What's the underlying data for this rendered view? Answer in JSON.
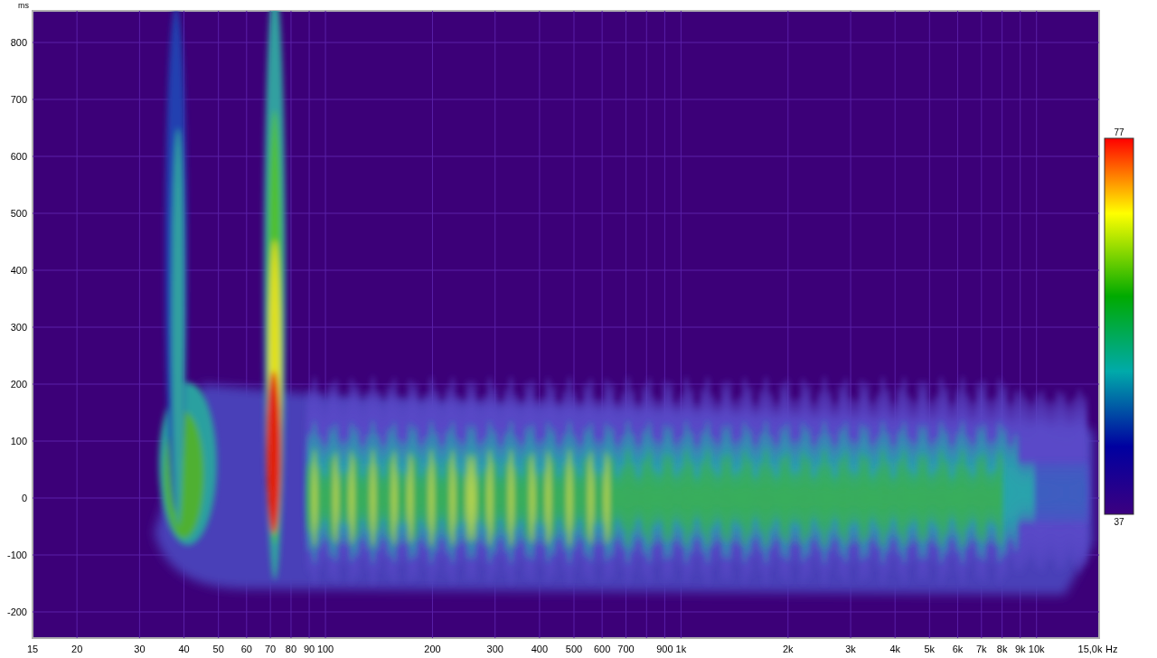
{
  "y_axis": {
    "unit": "ms",
    "ticks": [
      "800",
      "700",
      "600",
      "500",
      "400",
      "300",
      "200",
      "100",
      "0",
      "-100",
      "-200"
    ]
  },
  "x_axis": {
    "unit": "Hz",
    "ticks": [
      "15",
      "20",
      "30",
      "40",
      "50",
      "60",
      "70",
      "80",
      "90",
      "100",
      "200",
      "300",
      "400",
      "500",
      "600",
      "700",
      "900",
      "1k",
      "2k",
      "3k",
      "4k",
      "5k",
      "6k",
      "7k",
      "8k",
      "9k",
      "10k",
      "15,0k"
    ]
  },
  "color_scale": {
    "max": "77",
    "min": "37"
  }
}
